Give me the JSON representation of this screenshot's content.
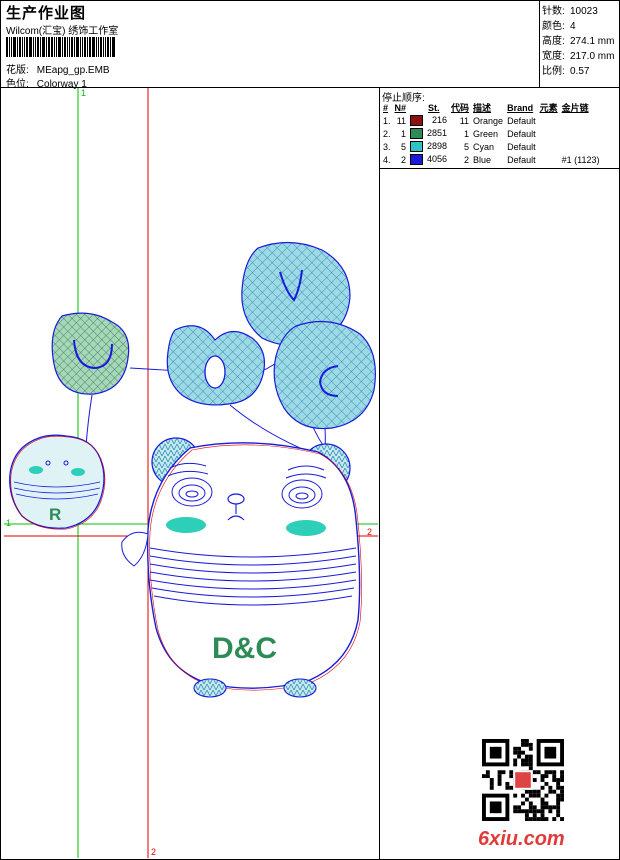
{
  "header": {
    "title": "生产作业图",
    "studio": "Wilcom(汇宝) 绣饰工作室",
    "design_label": "花版:",
    "design_value": "MEapg_gp.EMB",
    "colorway_label": "色位:",
    "colorway_value": "Colorway 1"
  },
  "stats": [
    {
      "label": "针数:",
      "value": "10023"
    },
    {
      "label": "颜色:",
      "value": "4"
    },
    {
      "label": "高度:",
      "value": "274.1 mm"
    },
    {
      "label": "宽度:",
      "value": "217.0 mm"
    },
    {
      "label": "比例:",
      "value": "0.57"
    }
  ],
  "sequence": {
    "title": "停止顺序:",
    "headers": [
      "#",
      "N#",
      "St.",
      "代码",
      "描述",
      "Brand",
      "元素",
      "金片链"
    ],
    "rows": [
      {
        "idx": "1.",
        "n": "11",
        "color": "#8b1010",
        "st": "216",
        "code": "11",
        "desc": "Orange",
        "brand": "Default",
        "elem": "",
        "seq": ""
      },
      {
        "idx": "2.",
        "n": "1",
        "color": "#2e8b57",
        "st": "2851",
        "code": "1",
        "desc": "Green",
        "brand": "Default",
        "elem": "",
        "seq": ""
      },
      {
        "idx": "3.",
        "n": "5",
        "color": "#2ec4c4",
        "st": "2898",
        "code": "5",
        "desc": "Cyan",
        "brand": "Default",
        "elem": "",
        "seq": ""
      },
      {
        "idx": "4.",
        "n": "2",
        "color": "#1a1adc",
        "st": "4056",
        "code": "2",
        "desc": "Blue",
        "brand": "Default",
        "elem": "",
        "seq": "#1 (1123)"
      }
    ]
  },
  "guides": {
    "green_v": "1",
    "green_h": "1",
    "red_v": "2",
    "red_h": "2"
  },
  "artwork": {
    "bear_text": "D&C",
    "small_text": "R"
  },
  "watermark": "6xiu.com",
  "colors": {
    "outline_blue": "#1a1adc",
    "fill_cyan": "#39b8cc",
    "fill_green": "#2e8b57",
    "guide_green": "#00c000",
    "guide_red": "#e00000",
    "cheek": "#2ecfb8"
  }
}
